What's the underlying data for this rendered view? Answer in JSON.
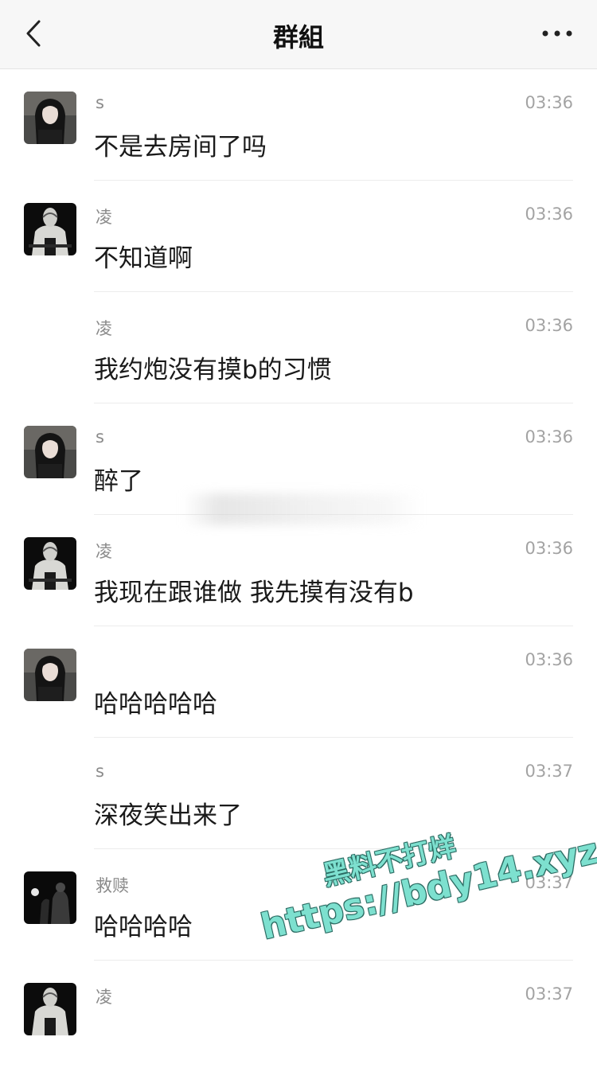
{
  "header": {
    "title": "群組",
    "back_icon": "chevron-left-icon",
    "more_icon": "more-horizontal-icon"
  },
  "messages": [
    {
      "sender": "s",
      "time": "03:36",
      "text": "不是去房间了吗",
      "avatar": "girl"
    },
    {
      "sender": "凌",
      "time": "03:36",
      "text": "不知道啊",
      "avatar": "mask"
    },
    {
      "sender": "凌",
      "time": "03:36",
      "text": "我约炮没有摸b的习惯",
      "avatar": "none"
    },
    {
      "sender": "s",
      "time": "03:36",
      "text": "醉了",
      "avatar": "girl"
    },
    {
      "sender": "凌",
      "time": "03:36",
      "text": "我现在跟谁做 我先摸有没有b",
      "avatar": "mask"
    },
    {
      "sender": "",
      "time": "03:36",
      "text": "哈哈哈哈哈",
      "avatar": "girl"
    },
    {
      "sender": "s",
      "time": "03:37",
      "text": "深夜笑出来了",
      "avatar": "none"
    },
    {
      "sender": "救赎",
      "time": "03:37",
      "text": "哈哈哈哈",
      "avatar": "dark"
    },
    {
      "sender": "凌",
      "time": "03:37",
      "text": "",
      "avatar": "mask"
    }
  ],
  "watermark": {
    "line1": "黑料不打烊",
    "line2": "https://bdy14.xyz"
  },
  "colors": {
    "header_bg": "#f7f7f7",
    "watermark": "#7de0cf"
  }
}
